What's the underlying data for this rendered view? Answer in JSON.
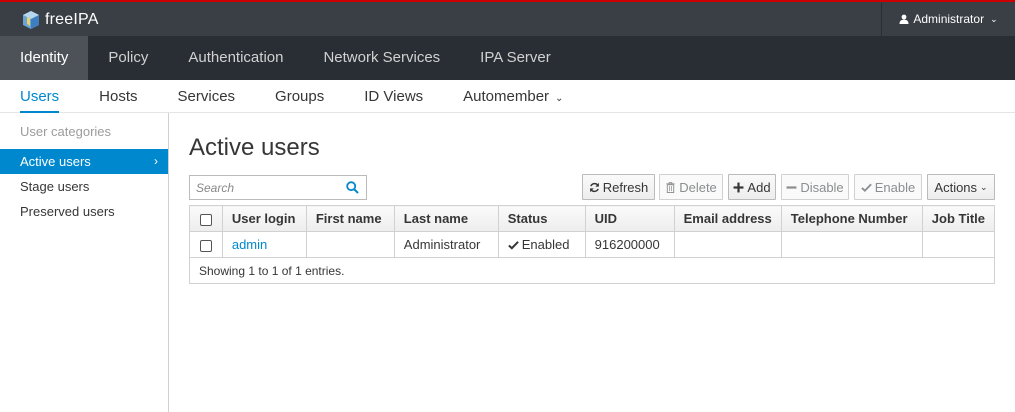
{
  "brand": {
    "name": "freeIPA"
  },
  "user_menu": {
    "label": "Administrator"
  },
  "main_nav": [
    {
      "label": "Identity",
      "active": true
    },
    {
      "label": "Policy",
      "active": false
    },
    {
      "label": "Authentication",
      "active": false
    },
    {
      "label": "Network Services",
      "active": false
    },
    {
      "label": "IPA Server",
      "active": false
    }
  ],
  "sub_nav": [
    {
      "label": "Users",
      "active": true
    },
    {
      "label": "Hosts",
      "active": false
    },
    {
      "label": "Services",
      "active": false
    },
    {
      "label": "Groups",
      "active": false
    },
    {
      "label": "ID Views",
      "active": false
    },
    {
      "label": "Automember",
      "active": false,
      "dropdown": true
    }
  ],
  "sidebar": {
    "heading": "User categories",
    "items": [
      {
        "label": "Active users",
        "active": true
      },
      {
        "label": "Stage users",
        "active": false
      },
      {
        "label": "Preserved users",
        "active": false
      }
    ]
  },
  "page": {
    "title": "Active users"
  },
  "search": {
    "placeholder": "Search"
  },
  "toolbar": {
    "refresh": "Refresh",
    "delete": "Delete",
    "add": "Add",
    "disable": "Disable",
    "enable": "Enable",
    "actions": "Actions"
  },
  "table": {
    "columns": [
      "User login",
      "First name",
      "Last name",
      "Status",
      "UID",
      "Email address",
      "Telephone Number",
      "Job Title"
    ],
    "rows": [
      {
        "login": "admin",
        "first_name": "",
        "last_name": "Administrator",
        "status": "Enabled",
        "uid": "916200000",
        "email": "",
        "phone": "",
        "job_title": ""
      }
    ],
    "footer": "Showing 1 to 1 of 1 entries."
  },
  "colors": {
    "accent": "#0088ce",
    "topbar": "#393f44",
    "nav": "#292e34",
    "nav_active": "#4d5258"
  }
}
